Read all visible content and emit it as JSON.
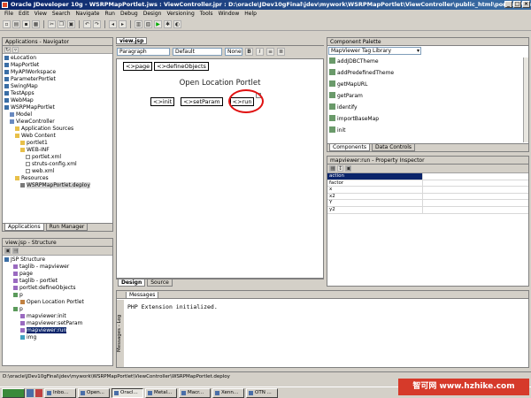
{
  "window": {
    "title": "Oracle JDeveloper 10g - WSRPMapPortlet.jws : ViewController.jpr : D:\\oracle\\JDev10gFinal\\jdev\\mywork\\WSRPMapPortlet\\ViewController\\public_html\\portlet1\\html..."
  },
  "menu": [
    "File",
    "Edit",
    "View",
    "Search",
    "Navigate",
    "Run",
    "Debug",
    "Design",
    "Versioning",
    "Tools",
    "Window",
    "Help"
  ],
  "navigator": {
    "title": "Applications - Navigator",
    "items": [
      {
        "label": "eLocation",
        "indent": 0
      },
      {
        "label": "MapPortlet",
        "indent": 0
      },
      {
        "label": "MyAPIWorkspace",
        "indent": 0
      },
      {
        "label": "ParameterPortlet",
        "indent": 0
      },
      {
        "label": "SwingMap",
        "indent": 0
      },
      {
        "label": "TestApps",
        "indent": 0
      },
      {
        "label": "WebMap",
        "indent": 0
      },
      {
        "label": "WSRPMapPortlet",
        "indent": 0
      },
      {
        "label": "Model",
        "indent": 1
      },
      {
        "label": "ViewController",
        "indent": 1
      },
      {
        "label": "Application Sources",
        "indent": 2
      },
      {
        "label": "Web Content",
        "indent": 2
      },
      {
        "label": "portlet1",
        "indent": 3
      },
      {
        "label": "WEB-INF",
        "indent": 3
      },
      {
        "label": "portlet.xml",
        "indent": 4
      },
      {
        "label": "struts-config.xml",
        "indent": 4
      },
      {
        "label": "web.xml",
        "indent": 4
      },
      {
        "label": "Resources",
        "indent": 2
      },
      {
        "label": "WSRPMapPortlet.deploy",
        "indent": 3
      }
    ],
    "tabs": [
      "Applications",
      "Run Manager"
    ]
  },
  "structure": {
    "title": "view.jsp - Structure",
    "items": [
      {
        "label": "JSP Structure",
        "indent": 0
      },
      {
        "label": "taglib - mapviewer",
        "indent": 1
      },
      {
        "label": "page",
        "indent": 1
      },
      {
        "label": "taglib - portlet",
        "indent": 1
      },
      {
        "label": "portlet:defineObjects",
        "indent": 1
      },
      {
        "label": "p",
        "indent": 1
      },
      {
        "label": "Open Location Portlet",
        "indent": 2
      },
      {
        "label": "p",
        "indent": 1
      },
      {
        "label": "mapviewer:init",
        "indent": 2
      },
      {
        "label": "mapviewer:setParam",
        "indent": 2
      },
      {
        "label": "mapviewer:run",
        "indent": 2
      },
      {
        "label": "img",
        "indent": 2
      }
    ]
  },
  "editor": {
    "tab": "view.jsp",
    "style_select": "Paragraph",
    "class_select": "Default",
    "size_select": "None",
    "page_tag": "page",
    "define_tag": "defineObjects",
    "heading": "Open Location Portlet",
    "init_tag": "init",
    "setparam_tag": "setParam",
    "run_tag": "run",
    "tabs": [
      "Design",
      "Source"
    ]
  },
  "palette": {
    "title": "Component Palette",
    "select": "MapViewer Tag Library",
    "items": [
      "addJDBCTheme",
      "addPredefinedTheme",
      "getMapURL",
      "getParam",
      "identify",
      "importBaseMap",
      "init"
    ],
    "tabs": [
      "Components",
      "Data Controls"
    ]
  },
  "inspector": {
    "title": "mapviewer:run - Property Inspector",
    "rows": [
      "action",
      "factor",
      "x",
      "x2",
      "Y",
      "y2"
    ],
    "selected_row": "action"
  },
  "messages": {
    "tab": "Messages",
    "text": "PHP Extension initialized.",
    "side_label": "Messages - Log"
  },
  "status": {
    "path": "D:\\oracle\\JDev10gFinal\\jdev\\mywork\\WSRPMapPortlet\\ViewController\\WSRPMapPortlet.deploy"
  },
  "taskbar": [
    "Inbo...",
    "Open...",
    "Oracl...",
    "Metal...",
    "Macr...",
    "Xenn...",
    "OTN ..."
  ],
  "watermark": "智可网 www.hzhike.com",
  "accent": "#0a246a",
  "highlight": "#e01010"
}
